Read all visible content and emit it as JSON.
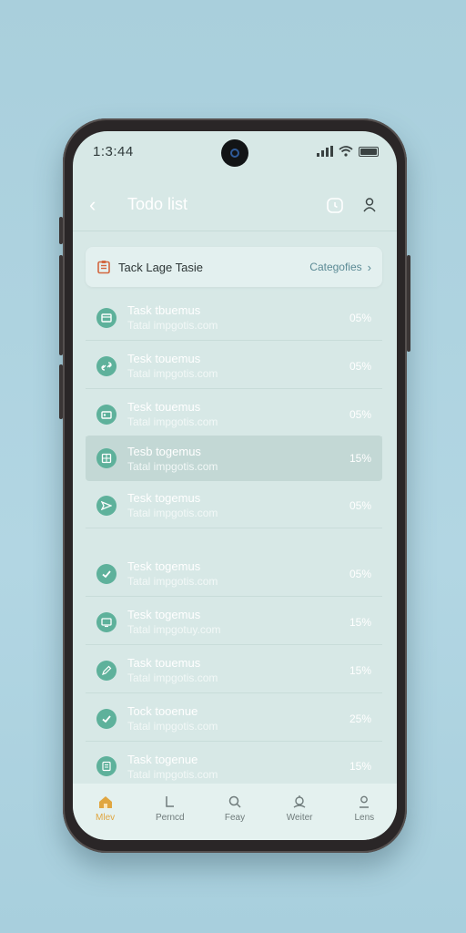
{
  "status_bar": {
    "time": "1:3:44"
  },
  "header": {
    "title": "Todo list"
  },
  "category_bar": {
    "title": "Tack Lage Tasie",
    "link": "Categofies"
  },
  "tasks": [
    {
      "title": "Task tbuemus",
      "subtitle": "Tatal impgotis.com",
      "percent": "05%",
      "icon": "calendar-icon"
    },
    {
      "title": "Tesk touemus",
      "subtitle": "Tatal impgotis.com",
      "percent": "05%",
      "icon": "link-icon"
    },
    {
      "title": "Tesk touemus",
      "subtitle": "Tatal impgotis.com",
      "percent": "05%",
      "icon": "card-icon"
    },
    {
      "title": "Tesb togemus",
      "subtitle": "Tatal impgotis.com",
      "percent": "15%",
      "icon": "grid-icon",
      "highlight": true
    },
    {
      "title": "Tesk togemus",
      "subtitle": "Tatal impgotis.com",
      "percent": "05%",
      "icon": "send-icon"
    },
    {
      "title": "Tesk togemus",
      "subtitle": "Tatal impgotis.com",
      "percent": "05%",
      "icon": "check-icon"
    },
    {
      "title": "Tesk togemus",
      "subtitle": "Tatal impgotuy.com",
      "percent": "15%",
      "icon": "screen-icon"
    },
    {
      "title": "Task touemus",
      "subtitle": "Tatal impgotis.com",
      "percent": "15%",
      "icon": "pen-icon"
    },
    {
      "title": "Tock tooenue",
      "subtitle": "Tatal impgotis.com",
      "percent": "25%",
      "icon": "check-icon"
    },
    {
      "title": "Task togenue",
      "subtitle": "Tatal impgotis.com",
      "percent": "15%",
      "icon": "list-icon"
    }
  ],
  "nav": [
    {
      "label": "Mlev",
      "icon": "home-icon",
      "active": true
    },
    {
      "label": "Perncd",
      "icon": "period-icon"
    },
    {
      "label": "Feay",
      "icon": "search-icon"
    },
    {
      "label": "Weiter",
      "icon": "weather-icon"
    },
    {
      "label": "Lens",
      "icon": "profile-icon"
    }
  ],
  "colors": {
    "accent": "#5eb19b",
    "nav_active": "#e0a640",
    "screen_bg": "#d7e8e6"
  }
}
